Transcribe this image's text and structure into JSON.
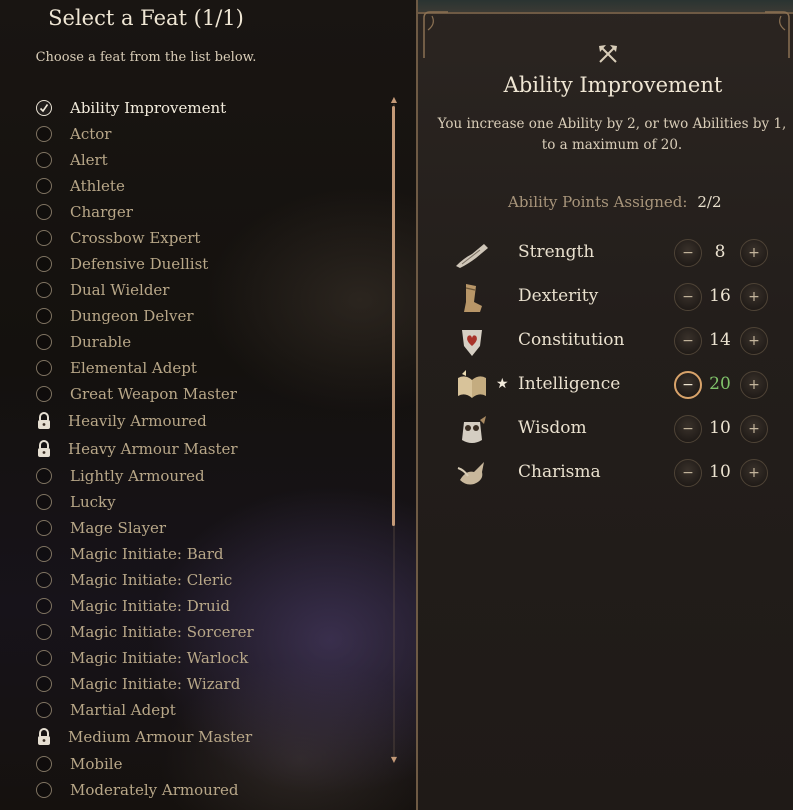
{
  "feat_panel": {
    "title": "Select a Feat (1/1)",
    "subtitle": "Choose a feat from the list below.",
    "feats": [
      {
        "label": "Ability Improvement",
        "state": "selected"
      },
      {
        "label": "Actor",
        "state": "available"
      },
      {
        "label": "Alert",
        "state": "available"
      },
      {
        "label": "Athlete",
        "state": "available"
      },
      {
        "label": "Charger",
        "state": "available"
      },
      {
        "label": "Crossbow Expert",
        "state": "available"
      },
      {
        "label": "Defensive Duellist",
        "state": "available"
      },
      {
        "label": "Dual Wielder",
        "state": "available"
      },
      {
        "label": "Dungeon Delver",
        "state": "available"
      },
      {
        "label": "Durable",
        "state": "available"
      },
      {
        "label": "Elemental Adept",
        "state": "available"
      },
      {
        "label": "Great Weapon Master",
        "state": "available"
      },
      {
        "label": "Heavily Armoured",
        "state": "locked"
      },
      {
        "label": "Heavy Armour Master",
        "state": "locked"
      },
      {
        "label": "Lightly Armoured",
        "state": "available"
      },
      {
        "label": "Lucky",
        "state": "available"
      },
      {
        "label": "Mage Slayer",
        "state": "available"
      },
      {
        "label": "Magic Initiate: Bard",
        "state": "available"
      },
      {
        "label": "Magic Initiate: Cleric",
        "state": "available"
      },
      {
        "label": "Magic Initiate: Druid",
        "state": "available"
      },
      {
        "label": "Magic Initiate: Sorcerer",
        "state": "available"
      },
      {
        "label": "Magic Initiate: Warlock",
        "state": "available"
      },
      {
        "label": "Magic Initiate: Wizard",
        "state": "available"
      },
      {
        "label": "Martial Adept",
        "state": "available"
      },
      {
        "label": "Medium Armour Master",
        "state": "locked"
      },
      {
        "label": "Mobile",
        "state": "available"
      },
      {
        "label": "Moderately Armoured",
        "state": "available"
      }
    ]
  },
  "detail_panel": {
    "icon": "crossed-axes-icon",
    "title": "Ability Improvement",
    "description": "You increase one Ability by 2, or two Abilities by 1, to a maximum of 20.",
    "points_label": "Ability Points Assigned:",
    "points_value": "2/2",
    "abilities": [
      {
        "name": "Strength",
        "value": "8",
        "icon": "arm-icon",
        "starred": false,
        "at_max": false
      },
      {
        "name": "Dexterity",
        "value": "16",
        "icon": "boot-icon",
        "starred": false,
        "at_max": false
      },
      {
        "name": "Constitution",
        "value": "14",
        "icon": "heart-shield-icon",
        "starred": false,
        "at_max": false
      },
      {
        "name": "Intelligence",
        "value": "20",
        "icon": "open-book-icon",
        "starred": true,
        "at_max": true
      },
      {
        "name": "Wisdom",
        "value": "10",
        "icon": "owl-icon",
        "starred": false,
        "at_max": false
      },
      {
        "name": "Charisma",
        "value": "10",
        "icon": "bird-icon",
        "starred": false,
        "at_max": false
      }
    ],
    "star_glyph": "★",
    "minus_glyph": "−",
    "plus_glyph": "+"
  },
  "colors": {
    "accent": "#d8a36a",
    "max_value": "#7fc26a",
    "frame": "#6e5a44"
  }
}
